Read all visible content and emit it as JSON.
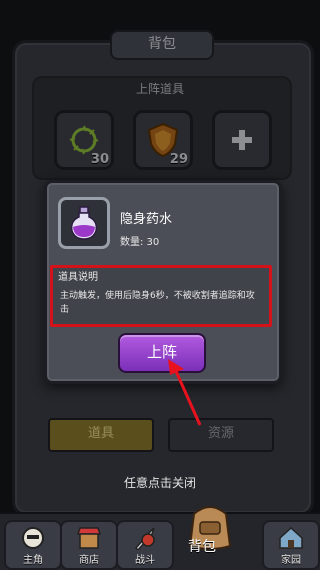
{
  "bag": {
    "title": "背包",
    "deck_title": "上阵道具",
    "slots": [
      {
        "icon": "thorn-wreath-icon",
        "count": "30"
      },
      {
        "icon": "shield-icon",
        "count": "29"
      },
      {
        "icon": "add-icon",
        "count": ""
      }
    ],
    "tabs": [
      {
        "label": "道具",
        "active": true
      },
      {
        "label": "资源",
        "active": false
      }
    ],
    "close_hint": "任意点击关闭"
  },
  "popup": {
    "item_icon": "purple-potion-icon",
    "item_name": "隐身药水",
    "quantity": "数量: 30",
    "desc_title": "道具说明",
    "desc_text": "主动触发，使用后隐身6秒，不被收割者追踪和攻击",
    "equip_label": "上阵"
  },
  "bottom_nav": {
    "items": [
      {
        "label": "主角",
        "icon": "hero-icon"
      },
      {
        "label": "商店",
        "icon": "shop-icon"
      },
      {
        "label": "战斗",
        "icon": "battle-icon"
      },
      {
        "label": "背包",
        "icon": "backpack-icon"
      },
      {
        "label": "家园",
        "icon": "home-icon"
      }
    ]
  },
  "colors": {
    "highlight": "#d4121b",
    "button": "#9b46d0",
    "arrow": "#e8121f"
  }
}
